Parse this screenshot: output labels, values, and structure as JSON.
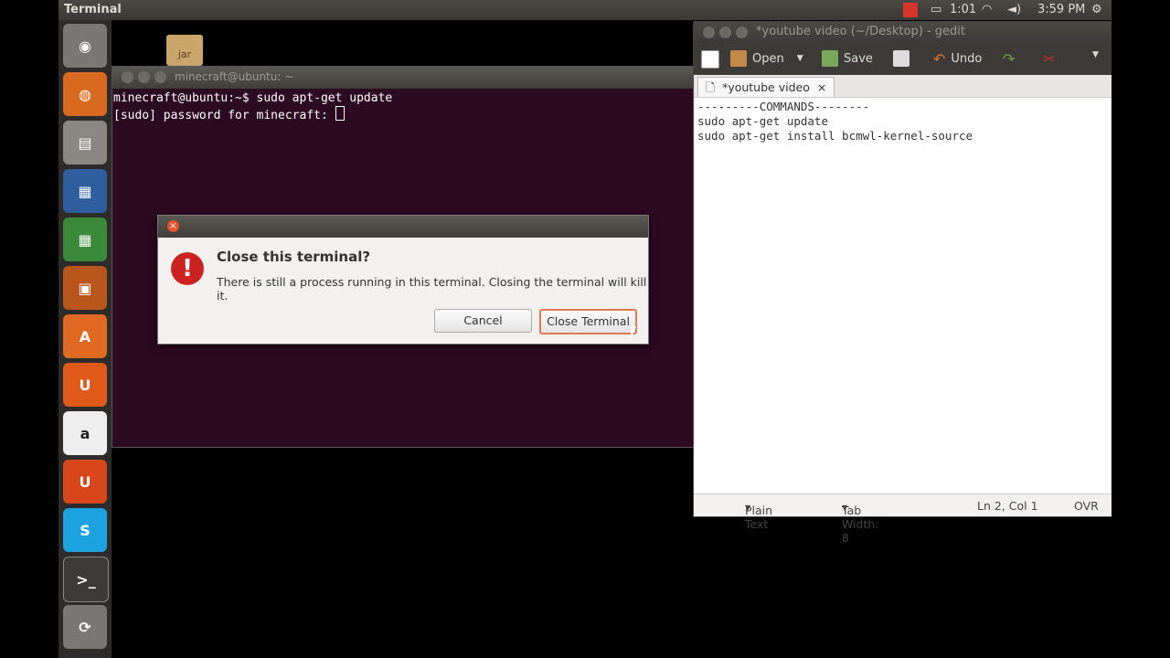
{
  "topbar": {
    "title": "Terminal",
    "battery": "1:01",
    "time": "3:59 PM"
  },
  "desktop": {
    "icon_label": "jar"
  },
  "terminal": {
    "window_title": "minecraft@ubuntu: ~",
    "lines": [
      "minecraft@ubuntu:~$ sudo apt-get update",
      "[sudo] password for minecraft: "
    ]
  },
  "dialog": {
    "title": "Close this terminal?",
    "message": "There is still a process running in this terminal. Closing the terminal will kill it.",
    "cancel_label": "Cancel",
    "confirm_label": "Close Terminal"
  },
  "gedit": {
    "window_title": "*youtube video (~/Desktop) - gedit",
    "toolbar": {
      "open": "Open",
      "save": "Save",
      "undo": "Undo"
    },
    "tab_label": "*youtube video",
    "content": [
      "---------COMMANDS--------",
      "sudo apt-get update",
      "sudo apt-get install bcmwl-kernel-source"
    ],
    "status": {
      "language": "Plain Text",
      "tab_width": "Tab Width:  8",
      "position": "Ln 2, Col 1",
      "mode": "OVR"
    }
  }
}
